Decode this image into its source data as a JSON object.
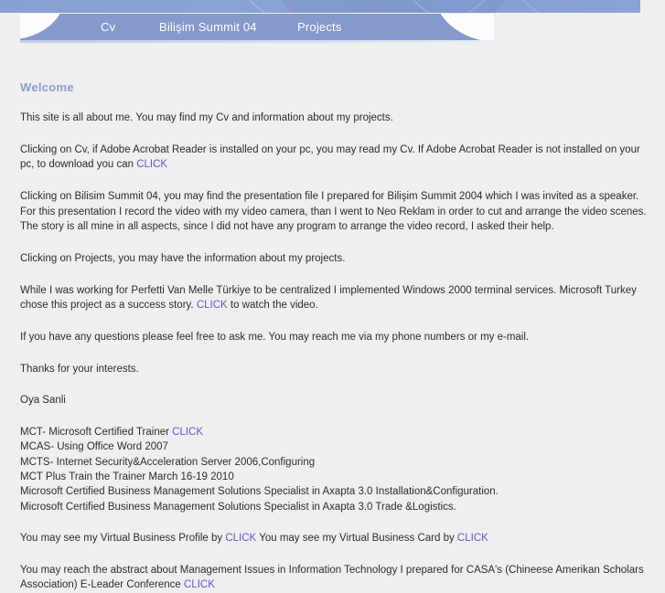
{
  "theme": {
    "banner_color": "#8aa0d0",
    "nav_color": "#8699cb",
    "heading_color": "#8b9dd4",
    "link_color": "#5a5ad2",
    "page_background": "#efefef",
    "body_text_color": "#2d2d2d"
  },
  "nav": {
    "items": [
      {
        "label": "Cv"
      },
      {
        "label": "Bilişim Summit 04"
      },
      {
        "label": "Projects"
      }
    ]
  },
  "main": {
    "heading": "Welcome",
    "intro": "This site is all about me. You may find my Cv and information about my projects.",
    "acrobat_paragraph": {
      "text_before": "Clicking on Cv, if Adobe Acrobat Reader is installed on your pc, you may read my Cv. If Adobe Acrobat Reader is not installed on your pc, to download you can ",
      "link": "CLICK"
    },
    "summit_paragraph": "Clicking on Bilisim Summit 04, you may find the presentation file I prepared for Bilişim Summit 2004 which I was invited as a speaker. For this presentation I record the video with my video camera, than I went to Neo Reklam in order to cut and arrange the video scenes. The story is all mine in all aspects, since I did not have any program to arrange the video record, I asked their help.",
    "projects_paragraph": "Clicking on Projects, you may have the information about my projects.",
    "perfetti_paragraph": {
      "text_before": "While I was working for Perfetti Van Melle Türkiye to be centralized I implemented Windows 2000 terminal services. Microsoft Turkey chose this project as a success story. ",
      "link": "CLICK",
      "text_after": " to watch the video."
    },
    "questions_paragraph": "If you have any questions please feel free to ask me. You may reach me via my phone numbers or my e-mail.",
    "thanks_paragraph": "Thanks for your interests.",
    "signature": "Oya Sanli",
    "certifications": [
      {
        "text": "MCT- Microsoft Certified Trainer ",
        "link": "CLICK"
      },
      {
        "text": "MCAS- Using Office Word 2007",
        "link": ""
      },
      {
        "text": "MCTS- Internet Security&Acceleration Server 2006,Configuring",
        "link": ""
      },
      {
        "text": "MCT Plus Train the Trainer March 16-19 2010",
        "link": ""
      },
      {
        "text": "Microsoft Certified Business Management Solutions Specialist in Axapta 3.0 Installation&Configuration.",
        "link": ""
      },
      {
        "text": "Microsoft Certified Business Management Solutions Specialist in Axapta 3.0 Trade &Logistics.",
        "link": ""
      }
    ],
    "virtual_paragraph": {
      "text_before": "You may see my Virtual Business Profile by ",
      "link1": "CLICK",
      "text_middle": " You may see my Virtual Business Card by ",
      "link2": "CLICK"
    },
    "casa_paragraph": {
      "text_before": "You may reach the abstract about Management Issues in Information Technology I prepared for CASA's (Chineese Amerikan Scholars Association) E-Leader Conference ",
      "link": "CLICK"
    }
  }
}
